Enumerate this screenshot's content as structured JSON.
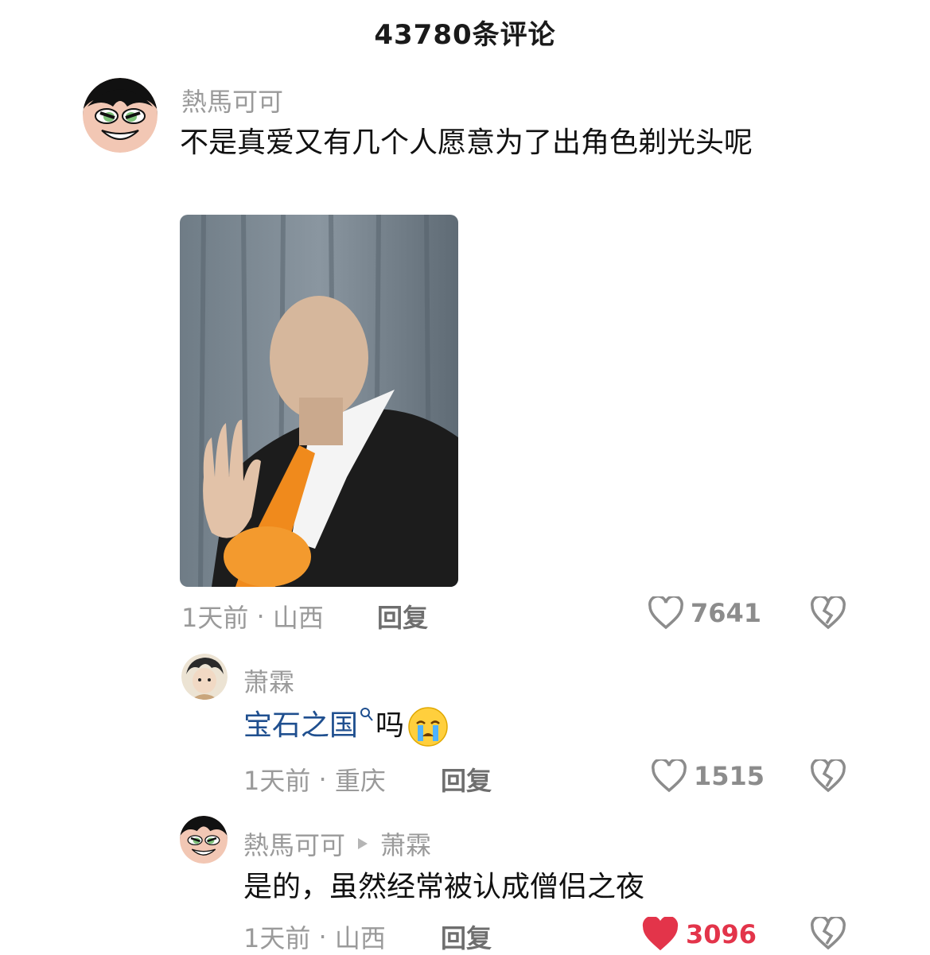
{
  "header": {
    "title": "43780条评论"
  },
  "comments": [
    {
      "username": "熱馬可可",
      "text": "不是真爱又有几个人愿意为了出角色剃光头呢",
      "time": "1天前",
      "location": "山西",
      "reply_label": "回复",
      "likes": "7641",
      "liked": false
    },
    {
      "username": "萧霖",
      "link_text": "宝石之国",
      "text_after": "吗",
      "time": "1天前",
      "location": "重庆",
      "reply_label": "回复",
      "likes": "1515",
      "liked": false
    },
    {
      "username": "熱馬可可",
      "reply_to": "萧霖",
      "text": "是的，虽然经常被认成僧侣之夜",
      "time": "1天前",
      "location": "山西",
      "reply_label": "回复",
      "likes": "3096",
      "liked": true
    }
  ],
  "colors": {
    "liked_heart": "#e3344a",
    "meta_gray": "#9a9a9a",
    "link_blue": "#1f4f8f"
  },
  "icons": [
    "heart-icon",
    "broken-heart-icon",
    "search-icon",
    "crying-emoji",
    "play-arrow-icon"
  ]
}
